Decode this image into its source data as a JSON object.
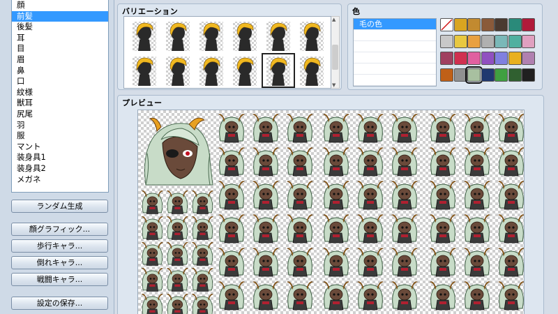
{
  "parts": {
    "items": [
      "顔",
      "前髪",
      "後髪",
      "耳",
      "目",
      "眉",
      "鼻",
      "口",
      "紋様",
      "獣耳",
      "尻尾",
      "羽",
      "服",
      "マント",
      "装身具1",
      "装身具2",
      "メガネ"
    ],
    "selected_index": 1
  },
  "buttons": {
    "random": "ランダム生成",
    "face_graphic": "顔グラフィック...",
    "walking_char": "歩行キャラ...",
    "fallen_char": "倒れキャラ...",
    "battle_char": "戦闘キャラ...",
    "save_settings": "設定の保存..."
  },
  "variation": {
    "title": "バリエーション",
    "count": 12,
    "selected_index": 10,
    "hair_color": "#f0b820"
  },
  "color": {
    "title": "色",
    "list": [
      "毛の色",
      "",
      "",
      "",
      "",
      ""
    ],
    "selected_index": 0,
    "swatches": [
      "none",
      "#d9a520",
      "#c28a30",
      "#8a5a3a",
      "#4a3a30",
      "#2a8a7a",
      "#b01a3a",
      "#c8c8c8",
      "#e8c840",
      "#e8a040",
      "#b0b0b0",
      "#7ab8b8",
      "#50b0a0",
      "#e0a0c0",
      "#a04060",
      "#d03050",
      "#e060a0",
      "#9050c0",
      "#8080e0",
      "#e8b020",
      "#b080b0",
      "#c06018",
      "#909090",
      "#a8c0a0",
      "#203870",
      "#40a040",
      "#306030",
      "#202020"
    ],
    "selected_swatch": 23
  },
  "preview": {
    "title": "プレビュー",
    "hair_color": "#c8dcc8",
    "horn_color": "#e8a020",
    "skin_color": "#6a4a3a"
  }
}
